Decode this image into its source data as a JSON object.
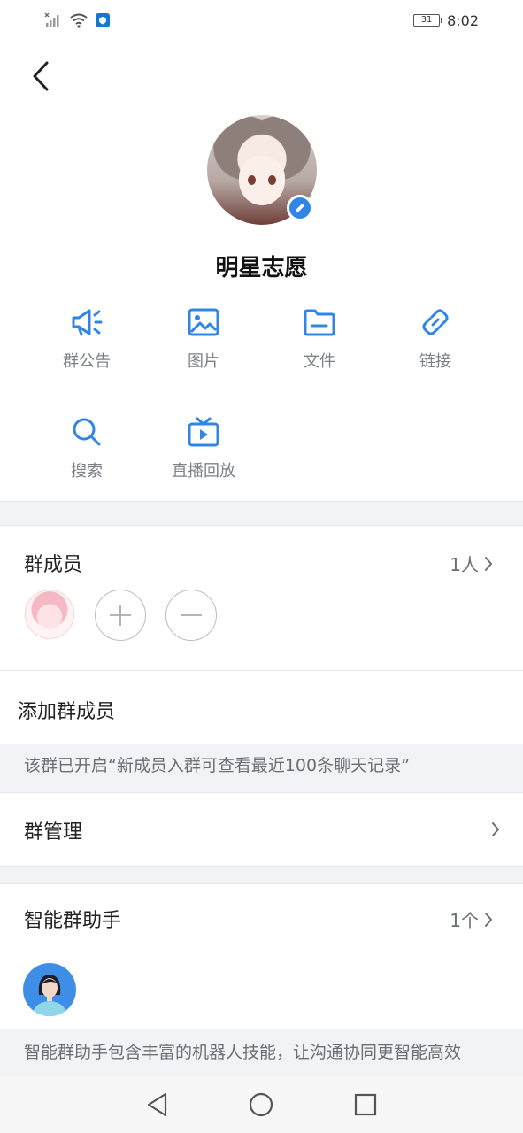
{
  "status_bar": {
    "time": "8:02",
    "battery": "31"
  },
  "group": {
    "name": "明星志愿"
  },
  "features": [
    {
      "label": "群公告",
      "icon": "megaphone-icon"
    },
    {
      "label": "图片",
      "icon": "image-icon"
    },
    {
      "label": "文件",
      "icon": "folder-icon"
    },
    {
      "label": "链接",
      "icon": "link-icon"
    },
    {
      "label": "搜索",
      "icon": "search-icon"
    },
    {
      "label": "直播回放",
      "icon": "tv-play-icon"
    }
  ],
  "members": {
    "title": "群成员",
    "count": "1人"
  },
  "add_member": {
    "label": "添加群成员"
  },
  "notice": {
    "text": "该群已开启“新成员入群可查看最近100条聊天记录”"
  },
  "management": {
    "title": "群管理"
  },
  "assistant": {
    "title": "智能群助手",
    "count": "1个",
    "description": "智能群助手包含丰富的机器人技能，让沟通协同更智能高效"
  },
  "colors": {
    "accent": "#2f86e5",
    "muted": "#7d8187",
    "band": "#f1f3f6"
  }
}
